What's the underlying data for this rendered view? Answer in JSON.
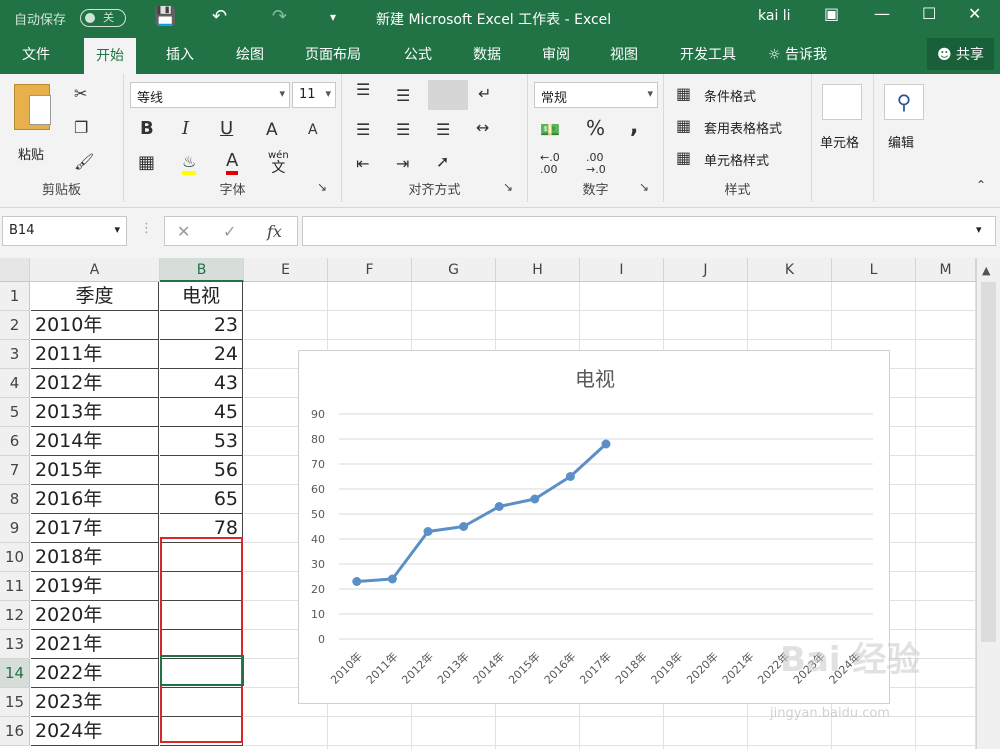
{
  "titlebar": {
    "autosave_label": "自动保存",
    "autosave_state": "关",
    "doc_title": "新建 Microsoft Excel 工作表 - Excel",
    "user_name": "kai li"
  },
  "tabs": [
    "文件",
    "开始",
    "插入",
    "绘图",
    "页面布局",
    "公式",
    "数据",
    "审阅",
    "视图",
    "开发工具"
  ],
  "tellme": "告诉我",
  "share": "共享",
  "ribbon": {
    "clipboard": {
      "paste": "粘贴",
      "label": "剪贴板"
    },
    "font": {
      "name": "等线",
      "size": "11",
      "label": "字体",
      "bold": "B",
      "italic": "I",
      "underline": "U",
      "grow": "A",
      "shrink": "A",
      "font_color": "A",
      "phonetic_top": "wén",
      "phonetic_bottom": "文"
    },
    "alignment": {
      "label": "对齐方式"
    },
    "number": {
      "format": "常规",
      "label": "数字",
      "percent": "%",
      "comma": ","
    },
    "styles": {
      "conditional": "条件格式",
      "table": "套用表格格式",
      "cell_styles": "单元格样式",
      "label": "样式"
    },
    "cells": {
      "label": "单元格"
    },
    "editing": {
      "label": "编辑"
    }
  },
  "formula_bar": {
    "name_box": "B14",
    "fx": "fx",
    "value": ""
  },
  "columns": [
    "A",
    "B",
    "E",
    "F",
    "G",
    "H",
    "I",
    "J",
    "K",
    "L",
    "M"
  ],
  "rows": [
    {
      "n": "1",
      "a": "季度",
      "b": "电视"
    },
    {
      "n": "2",
      "a": "2010年",
      "b": "23"
    },
    {
      "n": "3",
      "a": "2011年",
      "b": "24"
    },
    {
      "n": "4",
      "a": "2012年",
      "b": "43"
    },
    {
      "n": "5",
      "a": "2013年",
      "b": "45"
    },
    {
      "n": "6",
      "a": "2014年",
      "b": "53"
    },
    {
      "n": "7",
      "a": "2015年",
      "b": "56"
    },
    {
      "n": "8",
      "a": "2016年",
      "b": "65"
    },
    {
      "n": "9",
      "a": "2017年",
      "b": "78"
    },
    {
      "n": "10",
      "a": "2018年",
      "b": ""
    },
    {
      "n": "11",
      "a": "2019年",
      "b": ""
    },
    {
      "n": "12",
      "a": "2020年",
      "b": ""
    },
    {
      "n": "13",
      "a": "2021年",
      "b": ""
    },
    {
      "n": "14",
      "a": "2022年",
      "b": ""
    },
    {
      "n": "15",
      "a": "2023年",
      "b": ""
    },
    {
      "n": "16",
      "a": "2024年",
      "b": ""
    }
  ],
  "chart_data": {
    "type": "line",
    "title": "电视",
    "categories": [
      "2010年",
      "2011年",
      "2012年",
      "2013年",
      "2014年",
      "2015年",
      "2016年",
      "2017年",
      "2018年",
      "2019年",
      "2020年",
      "2021年",
      "2022年",
      "2023年",
      "2024年"
    ],
    "series": [
      {
        "values": [
          23,
          24,
          43,
          45,
          53,
          56,
          65,
          78,
          null,
          null,
          null,
          null,
          null,
          null,
          null
        ],
        "color": "#5b8fc7"
      }
    ],
    "ylim": [
      0,
      90
    ],
    "yticks": [
      0,
      10,
      20,
      30,
      40,
      50,
      60,
      70,
      80,
      90
    ],
    "grid": true,
    "legend": "none"
  },
  "watermark": "Bai 经验",
  "watermark_url": "jingyan.baidu.com",
  "colors": {
    "excel_green": "#217346",
    "highlight_red": "#d9262b",
    "line": "#5b8fc7"
  }
}
